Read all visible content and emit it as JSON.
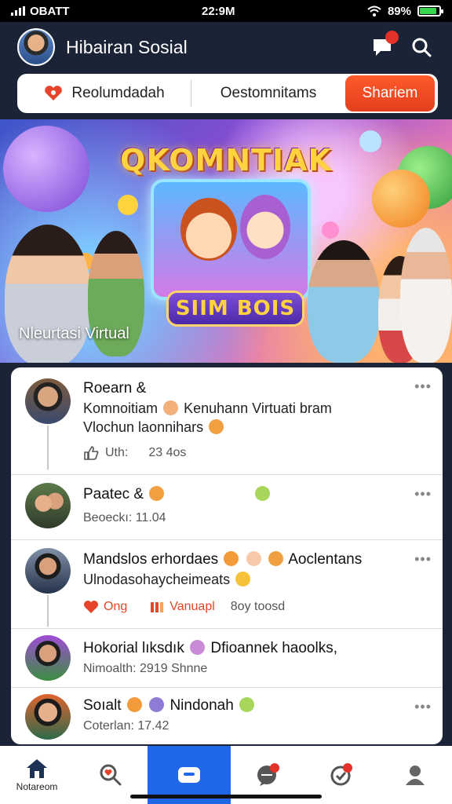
{
  "status_bar": {
    "carrier": "OBATT",
    "time": "22:9M",
    "battery": "89%",
    "battery_level": 0.89
  },
  "header": {
    "title": "Hibairan  Sosial",
    "chat_badge": "",
    "icons": [
      "chat-icon",
      "search-icon"
    ]
  },
  "tabs": [
    {
      "label": "Reolumdadah",
      "icon": "heart-chat-icon",
      "active": false
    },
    {
      "label": "Oestomnitams",
      "active": false
    },
    {
      "label": "Shariem",
      "active": true
    }
  ],
  "banner": {
    "title": "QKOMNTIAK",
    "screen_caption": "SIIM BOIS",
    "subtitle": "Nleurtasi Virtual"
  },
  "feed": [
    {
      "name": "Roearn &",
      "line1": "Komnoitiam",
      "line1_b": "Kenuhann Virtuati bram",
      "line2": "Vlochun laonnihars",
      "meta_like": "Uth:",
      "meta_count": "23 4os"
    },
    {
      "name": "Paatec &",
      "meta": "Beoeckı:  11.04"
    },
    {
      "name": "Mandslos erhordaes",
      "name_b": "Aoclentans",
      "line2": "Ulnodasohaycheimeats",
      "action1": "Ong",
      "action2": "Vanuapl",
      "action3": "8oy toosd"
    },
    {
      "name": "Hokorial lıksdık",
      "name_b": "Dfioannek haoolks,",
      "meta": "Nimoalth:  2919 Shnne"
    },
    {
      "name": "Soıalt",
      "name_b": "Nindonah",
      "meta": "Coterlan:  17.42"
    }
  ],
  "bottom_nav": [
    {
      "label": "Notareom",
      "icon": "home-icon"
    },
    {
      "label": "",
      "icon": "search-heart-icon"
    },
    {
      "label": "",
      "icon": "create-icon"
    },
    {
      "label": "",
      "icon": "messages-icon"
    },
    {
      "label": "",
      "icon": "notifications-icon"
    },
    {
      "label": "",
      "icon": "profile-icon"
    }
  ],
  "colors": {
    "accent": "#e5452a",
    "nav_active": "#1f67e6",
    "background": "#1b2336"
  }
}
